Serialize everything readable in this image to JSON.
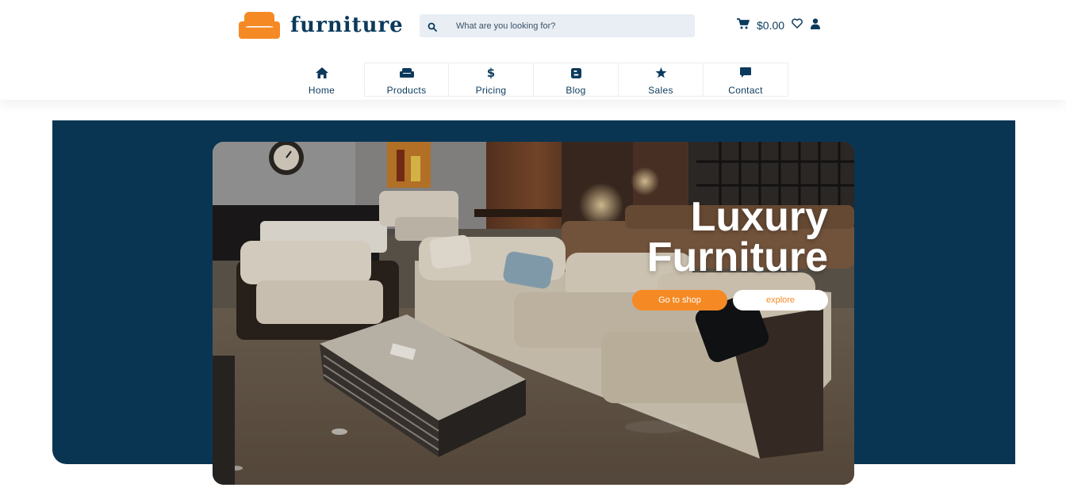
{
  "brand": {
    "name": "furniture"
  },
  "search": {
    "placeholder": "What are you looking for?"
  },
  "header": {
    "cart_total": "$0.00"
  },
  "nav": {
    "items": [
      {
        "label": "Home",
        "icon": "home-icon"
      },
      {
        "label": "Products",
        "icon": "sofa-icon"
      },
      {
        "label": "Pricing",
        "icon": "dollar-icon"
      },
      {
        "label": "Blog",
        "icon": "blog-icon"
      },
      {
        "label": "Sales",
        "icon": "star-icon"
      },
      {
        "label": "Contact",
        "icon": "chat-icon"
      }
    ]
  },
  "hero": {
    "title_line1": "Luxury",
    "title_line2": "Furniture",
    "primary_button": "Go to shop",
    "secondary_button": "explore"
  },
  "colors": {
    "brand_navy": "#0b3a5c",
    "hero_bg": "#093553",
    "accent_orange": "#f58a25"
  }
}
